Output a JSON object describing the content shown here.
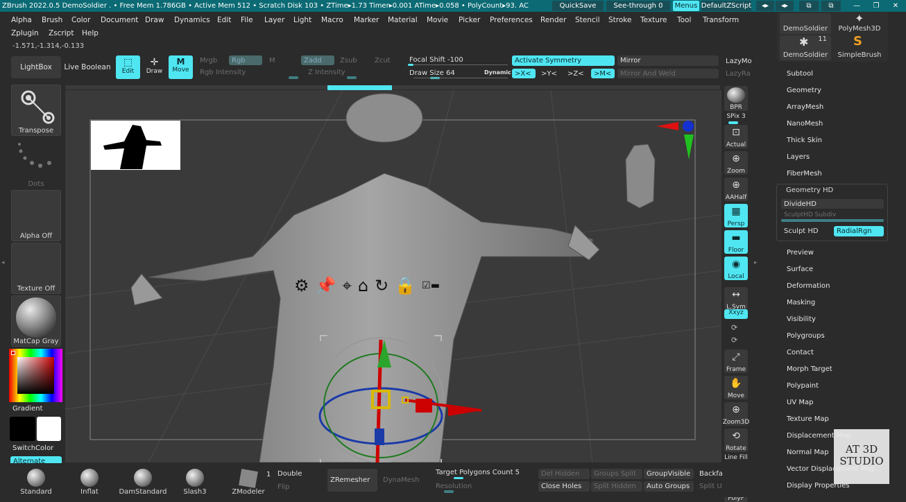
{
  "titlebar": {
    "text": "ZBrush 2022.0.5    DemoSoldier    . • Free Mem 1.786GB • Active Mem 512 • Scratch Disk 103 •  ZTime▸1.73 Timer▸0.001 ATime▸0.058 • PolyCount▸93.  AC",
    "quicksave": "QuickSave",
    "seethrough": "See-through  0",
    "menus": "Menus",
    "script": "DefaultZScript"
  },
  "menus": [
    "Alpha",
    "Brush",
    "Color",
    "Document",
    "Draw",
    "Dynamics",
    "Edit",
    "File",
    "Layer",
    "Light",
    "Macro",
    "Marker",
    "Material",
    "Movie",
    "Picker",
    "Preferences",
    "Render",
    "Stencil",
    "Stroke",
    "Texture",
    "Tool",
    "Transform"
  ],
  "menus2": [
    "Zplugin",
    "Zscript",
    "Help"
  ],
  "coords": "-1.571,-1.314,-0.133",
  "topshelf": {
    "lightbox": "LightBox",
    "liveboolean": "Live Boolean",
    "edit": "Edit",
    "draw": "Draw",
    "move": "Move",
    "mrgb": "Mrgb",
    "rgb": "Rgb",
    "m": "M",
    "rgb_intensity": "Rgb Intensity",
    "zadd": "Zadd",
    "zsub": "Zsub",
    "zcut": "Zcut",
    "z_intensity": "Z Intensity",
    "focal": "Focal Shift -100",
    "drawsize": "Draw Size 64",
    "dynamic": "Dynamic",
    "activate_symmetry": "Activate Symmetry",
    "mirror": "Mirror",
    "mirror_weld": "Mirror And Weld",
    "x": ">X<",
    "y": ">Y<",
    "z": ">Z<",
    "m_axis": ">M<",
    "lazymouse": "LazyMo",
    "lazyradius": "LazyRa"
  },
  "leftshelf": {
    "transpose": "Transpose",
    "dots": "Dots",
    "alpha": "Alpha Off",
    "texture": "Texture Off",
    "material": "MatCap Gray",
    "gradient": "Gradient",
    "switchcolor": "SwitchColor",
    "alternate": "Alternate"
  },
  "righttools": [
    {
      "name": "bpr",
      "label": "BPR"
    },
    {
      "name": "spix",
      "label": "SPix 3"
    },
    {
      "name": "actual",
      "label": "Actual"
    },
    {
      "name": "zoom",
      "label": "Zoom"
    },
    {
      "name": "aahalf",
      "label": "AAHalf"
    },
    {
      "name": "persp",
      "label": "Persp"
    },
    {
      "name": "floor",
      "label": "Floor"
    },
    {
      "name": "local",
      "label": "Local"
    },
    {
      "name": "lsym",
      "label": "L.Sym"
    },
    {
      "name": "xyz",
      "label": "Xxyz"
    },
    {
      "name": "frame",
      "label": "Frame"
    },
    {
      "name": "move",
      "label": "Move"
    },
    {
      "name": "zoom3d",
      "label": "Zoom3D"
    },
    {
      "name": "rotate",
      "label": "Rotate"
    },
    {
      "name": "linefill",
      "label": "Line Fill"
    },
    {
      "name": "polyf",
      "label": "PolyF"
    }
  ],
  "toolpanel": {
    "thumbs": [
      {
        "label": "DemoSoldier"
      },
      {
        "label": "PolyMesh3D"
      },
      {
        "label": "DemoSoldier",
        "count": "11"
      },
      {
        "label": "SimpleBrush"
      }
    ],
    "items": [
      "Subtool",
      "Geometry",
      "ArrayMesh",
      "NanoMesh",
      "Thick Skin",
      "Layers",
      "FiberMesh"
    ],
    "geometryhd": {
      "title": "Geometry HD",
      "divide": "DivideHD",
      "subdiv": "SculptHD Subdiv",
      "sculpt": "Sculpt HD",
      "radial": "RadialRgn"
    },
    "items2": [
      "Preview",
      "Surface",
      "Deformation",
      "Masking",
      "Visibility",
      "Polygroups",
      "Contact",
      "Morph Target",
      "Polypaint",
      "UV Map",
      "Texture Map",
      "Displacement Map",
      "Normal Map",
      "Vector Displacement Map",
      "Display Properties"
    ]
  },
  "watermark": {
    "line1": "AT 3D",
    "line2": "STUDIO"
  },
  "bottom": {
    "brushes": [
      "Standard",
      "Inflat",
      "DamStandard",
      "Slash3",
      "ZModeler"
    ],
    "count": "1",
    "double": "Double",
    "flip": "Flip",
    "zremesher": "ZRemesher",
    "dynamesh": "DynaMesh",
    "target": "Target Polygons Count 5",
    "resolution": "Resolution",
    "delhidden": "Del Hidden",
    "closeholes": "Close Holes",
    "groupssplit": "Groups Split",
    "splithidden": "Split Hidden",
    "groupvisible": "GroupVisible",
    "autogroups": "Auto Groups",
    "backface": "Backfa",
    "splitu": "Split U"
  },
  "colors": {
    "accent": "#4fe6f2",
    "titlebar": "#0b6a74",
    "panel": "#2b2b2b"
  }
}
